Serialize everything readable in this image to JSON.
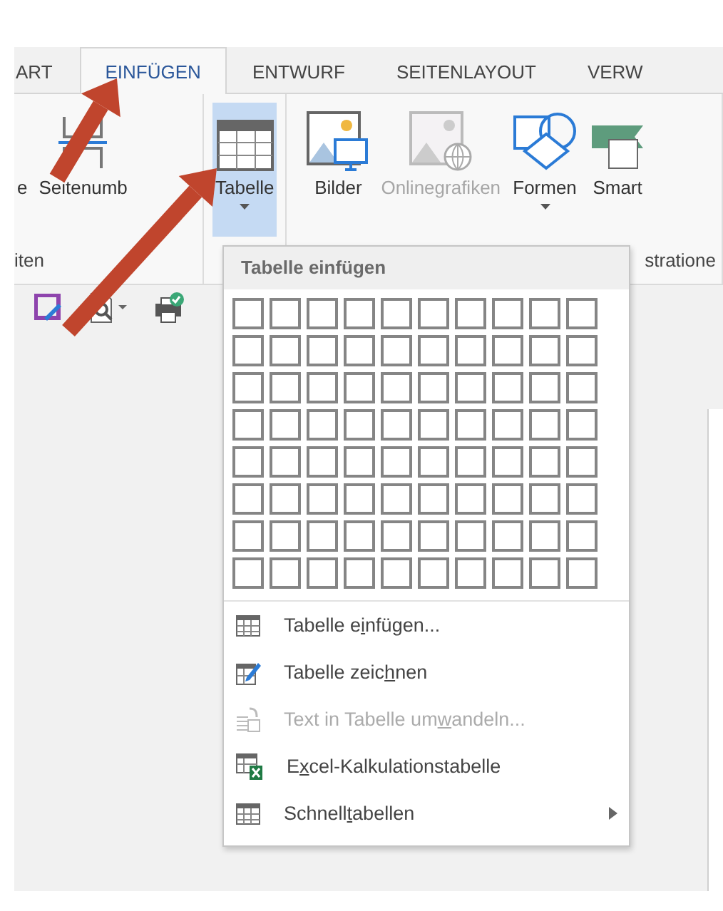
{
  "tabs": [
    {
      "label": "ART",
      "selected": false
    },
    {
      "label": "EINFÜGEN",
      "selected": true
    },
    {
      "label": "ENTWURF",
      "selected": false
    },
    {
      "label": "SEITENLAYOUT",
      "selected": false
    },
    {
      "label": "VERW",
      "selected": false
    }
  ],
  "ribbon": {
    "groups": [
      {
        "label": "iten",
        "commands": [
          {
            "kind": "partial",
            "label": "e",
            "selected": false,
            "disabled": false,
            "dropdown": false
          },
          {
            "kind": "pagebreak",
            "label": "Seitenumb",
            "selected": false,
            "disabled": false,
            "dropdown": false
          }
        ]
      },
      {
        "commands": [
          {
            "kind": "table",
            "label": "Tabelle",
            "selected": true,
            "disabled": false,
            "dropdown": true
          }
        ]
      },
      {
        "label": "stratione",
        "commands": [
          {
            "kind": "pictures",
            "label": "Bilder",
            "selected": false,
            "disabled": false,
            "dropdown": false
          },
          {
            "kind": "online",
            "label": "Onlinegrafiken",
            "selected": false,
            "disabled": true,
            "dropdown": false
          },
          {
            "kind": "shapes",
            "label": "Formen",
            "selected": false,
            "disabled": false,
            "dropdown": true
          },
          {
            "kind": "smart",
            "label": "Smart",
            "selected": false,
            "disabled": false,
            "dropdown": false
          }
        ]
      }
    ]
  },
  "menu": {
    "title": "Tabelle einfügen",
    "grid": [
      {
        "cells": [
          {
            "selected": false
          },
          {
            "selected": false
          },
          {
            "selected": false
          },
          {
            "selected": false
          },
          {
            "selected": false
          },
          {
            "selected": false
          },
          {
            "selected": false
          },
          {
            "selected": false
          },
          {
            "selected": false
          },
          {
            "selected": false
          }
        ]
      },
      {
        "cells": [
          {
            "selected": false
          },
          {
            "selected": false
          },
          {
            "selected": false
          },
          {
            "selected": false
          },
          {
            "selected": false
          },
          {
            "selected": false
          },
          {
            "selected": false
          },
          {
            "selected": false
          },
          {
            "selected": false
          },
          {
            "selected": false
          }
        ]
      },
      {
        "cells": [
          {
            "selected": false
          },
          {
            "selected": false
          },
          {
            "selected": false
          },
          {
            "selected": false
          },
          {
            "selected": false
          },
          {
            "selected": false
          },
          {
            "selected": false
          },
          {
            "selected": false
          },
          {
            "selected": false
          },
          {
            "selected": false
          }
        ]
      },
      {
        "cells": [
          {
            "selected": false
          },
          {
            "selected": false
          },
          {
            "selected": false
          },
          {
            "selected": false
          },
          {
            "selected": false
          },
          {
            "selected": false
          },
          {
            "selected": false
          },
          {
            "selected": false
          },
          {
            "selected": false
          },
          {
            "selected": false
          }
        ]
      },
      {
        "cells": [
          {
            "selected": false
          },
          {
            "selected": false
          },
          {
            "selected": false
          },
          {
            "selected": false
          },
          {
            "selected": false
          },
          {
            "selected": false
          },
          {
            "selected": false
          },
          {
            "selected": false
          },
          {
            "selected": false
          },
          {
            "selected": false
          }
        ]
      },
      {
        "cells": [
          {
            "selected": false
          },
          {
            "selected": false
          },
          {
            "selected": false
          },
          {
            "selected": false
          },
          {
            "selected": false
          },
          {
            "selected": false
          },
          {
            "selected": false
          },
          {
            "selected": false
          },
          {
            "selected": false
          },
          {
            "selected": false
          }
        ]
      },
      {
        "cells": [
          {
            "selected": false
          },
          {
            "selected": false
          },
          {
            "selected": false
          },
          {
            "selected": false
          },
          {
            "selected": false
          },
          {
            "selected": false
          },
          {
            "selected": false
          },
          {
            "selected": false
          },
          {
            "selected": false
          },
          {
            "selected": false
          }
        ]
      },
      {
        "cells": [
          {
            "selected": false
          },
          {
            "selected": false
          },
          {
            "selected": false
          },
          {
            "selected": false
          },
          {
            "selected": false
          },
          {
            "selected": false
          },
          {
            "selected": false
          },
          {
            "selected": false
          },
          {
            "selected": false
          },
          {
            "selected": false
          }
        ]
      }
    ],
    "items": [
      {
        "kind": "insert",
        "before": "Tabelle e",
        "access_key": "i",
        "after": "nfügen...",
        "disabled": false,
        "submenu": false
      },
      {
        "kind": "draw",
        "before": "Tabelle zeic",
        "access_key": "h",
        "after": "nen",
        "disabled": false,
        "submenu": false
      },
      {
        "kind": "convert",
        "before": "Text in Tabelle um",
        "access_key": "w",
        "after": "andeln...",
        "disabled": true,
        "submenu": false
      },
      {
        "kind": "excel",
        "before": "E",
        "access_key": "x",
        "after": "cel-Kalkulationstabelle",
        "disabled": false,
        "submenu": false
      },
      {
        "kind": "quick",
        "before": "Schnell",
        "access_key": "t",
        "after": "abellen",
        "disabled": false,
        "submenu": true
      }
    ]
  }
}
